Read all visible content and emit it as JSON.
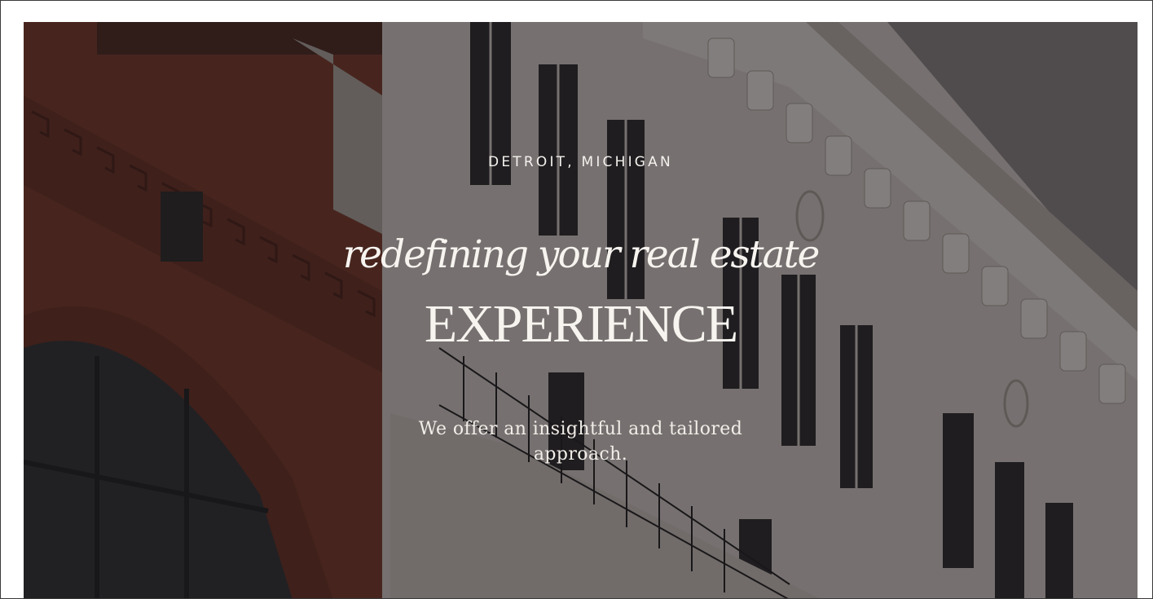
{
  "hero": {
    "location": "DETROIT, MICHIGAN",
    "headline_script": "redefining your real estate",
    "headline_caps": "EXPERIENCE",
    "tagline": "We offer an insightful and tailored approach."
  },
  "colors": {
    "brick": "#7a3a2a",
    "facade": "#d9d4cf",
    "sky": "#8a8688",
    "overlay": "#141012",
    "text": "#f7f4f0"
  }
}
